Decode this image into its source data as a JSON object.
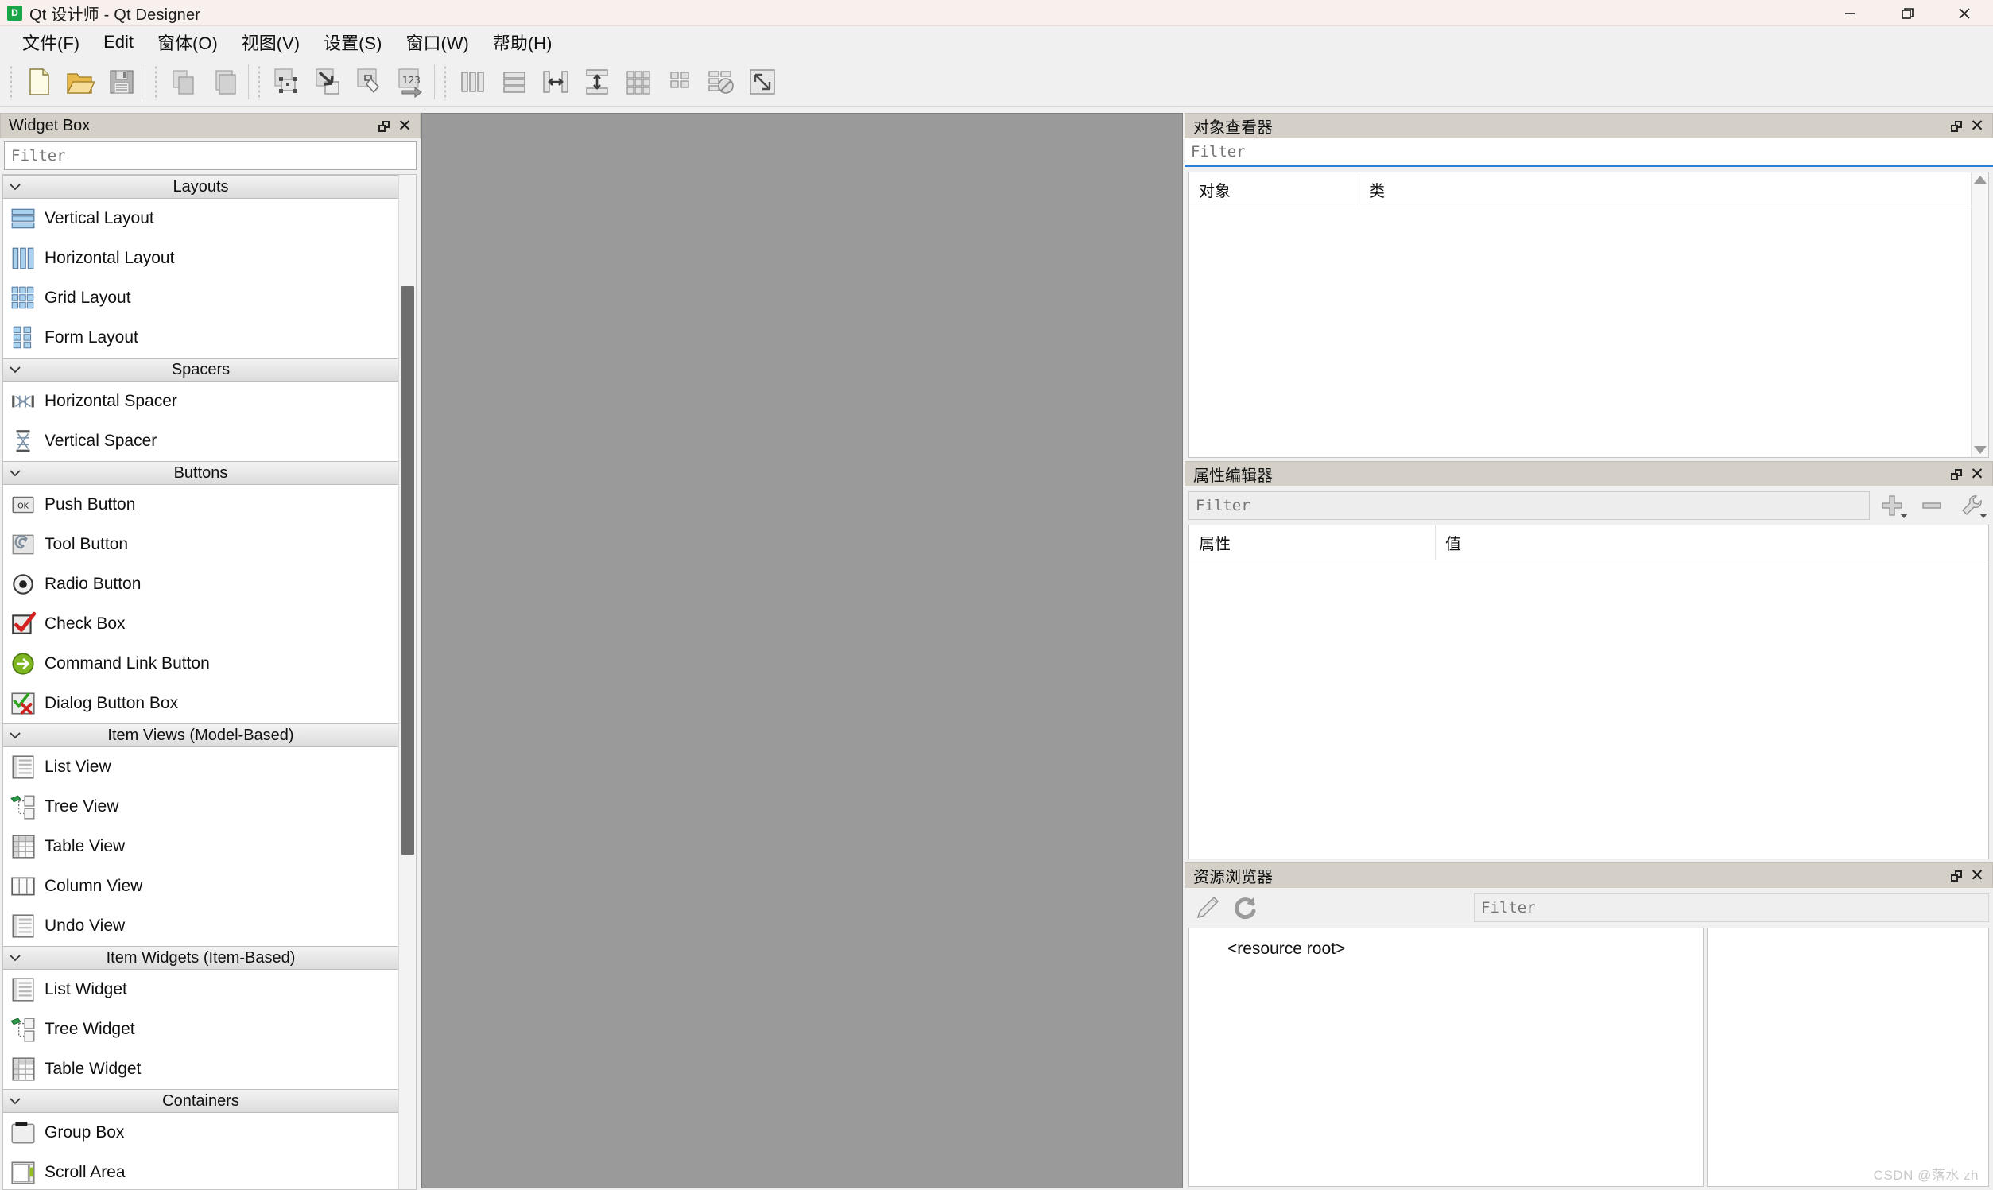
{
  "window": {
    "title": "Qt 设计师 - Qt Designer",
    "app_icon": "qt-designer-icon",
    "minimize_label": "—",
    "maximize_label": "❐",
    "close_label": "✕"
  },
  "menubar": {
    "items": [
      {
        "label": "文件(F)",
        "accel": "F"
      },
      {
        "label": "Edit",
        "accel": "E"
      },
      {
        "label": "窗体(O)",
        "accel": "O"
      },
      {
        "label": "视图(V)",
        "accel": "V"
      },
      {
        "label": "设置(S)",
        "accel": "S"
      },
      {
        "label": "窗口(W)",
        "accel": "W"
      },
      {
        "label": "帮助(H)",
        "accel": "H"
      }
    ]
  },
  "toolbar": {
    "groups": [
      {
        "buttons": [
          {
            "name": "new-form-button",
            "icon": "new-document-icon"
          },
          {
            "name": "open-form-button",
            "icon": "open-folder-icon"
          },
          {
            "name": "save-form-button",
            "icon": "floppy-save-icon"
          }
        ]
      },
      {
        "buttons": [
          {
            "name": "undo-button",
            "icon": "copy-pages-icon"
          },
          {
            "name": "redo-button",
            "icon": "paste-page-icon"
          }
        ]
      },
      {
        "buttons": [
          {
            "name": "edit-widgets-button",
            "icon": "edit-widgets-icon"
          },
          {
            "name": "edit-signals-slots-button",
            "icon": "signals-slots-icon"
          },
          {
            "name": "edit-buddies-button",
            "icon": "buddies-icon"
          },
          {
            "name": "edit-tab-order-button",
            "icon": "tab-order-123-icon"
          }
        ]
      },
      {
        "buttons": [
          {
            "name": "layout-horizontally-button",
            "icon": "layout-horizontal-icon"
          },
          {
            "name": "layout-vertically-button",
            "icon": "layout-vertical-icon"
          },
          {
            "name": "layout-splitter-horizontal-button",
            "icon": "splitter-horizontal-icon"
          },
          {
            "name": "layout-splitter-vertical-button",
            "icon": "splitter-vertical-icon"
          },
          {
            "name": "layout-grid-button",
            "icon": "layout-grid-icon"
          },
          {
            "name": "layout-form-button",
            "icon": "layout-form-icon"
          },
          {
            "name": "break-layout-button",
            "icon": "break-layout-icon"
          },
          {
            "name": "adjust-size-button",
            "icon": "adjust-size-icon"
          }
        ]
      }
    ]
  },
  "widget_box": {
    "title": "Widget Box",
    "filter_placeholder": "Filter",
    "filter_value": "",
    "float_button": "undock",
    "close_button": "close",
    "scroll_thumb": {
      "top_pct": 11,
      "height_pct": 56
    },
    "categories": [
      {
        "label": "Layouts",
        "expanded": true,
        "items": [
          {
            "label": "Vertical Layout",
            "icon": "vertical-layout-icon"
          },
          {
            "label": "Horizontal Layout",
            "icon": "horizontal-layout-icon"
          },
          {
            "label": "Grid Layout",
            "icon": "grid-layout-icon"
          },
          {
            "label": "Form Layout",
            "icon": "form-layout-icon"
          }
        ]
      },
      {
        "label": "Spacers",
        "expanded": true,
        "items": [
          {
            "label": "Horizontal Spacer",
            "icon": "horizontal-spacer-icon"
          },
          {
            "label": "Vertical Spacer",
            "icon": "vertical-spacer-icon"
          }
        ]
      },
      {
        "label": "Buttons",
        "expanded": true,
        "items": [
          {
            "label": "Push Button",
            "icon": "push-button-icon"
          },
          {
            "label": "Tool Button",
            "icon": "tool-button-icon"
          },
          {
            "label": "Radio Button",
            "icon": "radio-button-icon"
          },
          {
            "label": "Check Box",
            "icon": "check-box-icon"
          },
          {
            "label": "Command Link Button",
            "icon": "command-link-icon"
          },
          {
            "label": "Dialog Button Box",
            "icon": "dialog-button-box-icon"
          }
        ]
      },
      {
        "label": "Item Views (Model-Based)",
        "expanded": true,
        "items": [
          {
            "label": "List View",
            "icon": "list-view-icon"
          },
          {
            "label": "Tree View",
            "icon": "tree-view-icon"
          },
          {
            "label": "Table View",
            "icon": "table-view-icon"
          },
          {
            "label": "Column View",
            "icon": "column-view-icon"
          },
          {
            "label": "Undo View",
            "icon": "undo-view-icon"
          }
        ]
      },
      {
        "label": "Item Widgets (Item-Based)",
        "expanded": true,
        "items": [
          {
            "label": "List Widget",
            "icon": "list-widget-icon"
          },
          {
            "label": "Tree Widget",
            "icon": "tree-widget-icon"
          },
          {
            "label": "Table Widget",
            "icon": "table-widget-icon"
          }
        ]
      },
      {
        "label": "Containers",
        "expanded": true,
        "items": [
          {
            "label": "Group Box",
            "icon": "group-box-icon"
          },
          {
            "label": "Scroll Area",
            "icon": "scroll-area-icon"
          }
        ]
      }
    ]
  },
  "object_inspector": {
    "title": "对象查看器",
    "filter_placeholder": "Filter",
    "filter_value": "",
    "columns": [
      "对象",
      "类"
    ],
    "rows": []
  },
  "property_editor": {
    "title": "属性编辑器",
    "filter_placeholder": "Filter",
    "filter_value": "",
    "columns": [
      "属性",
      "值"
    ],
    "rows": [],
    "tools": [
      {
        "name": "add-dynamic-property-button",
        "icon": "plus-icon"
      },
      {
        "name": "remove-dynamic-property-button",
        "icon": "minus-icon"
      },
      {
        "name": "configure-property-editor-button",
        "icon": "wrench-icon"
      }
    ]
  },
  "resource_browser": {
    "title": "资源浏览器",
    "filter_placeholder": "Filter",
    "filter_value": "",
    "tools": [
      {
        "name": "edit-resources-button",
        "icon": "pencil-icon"
      },
      {
        "name": "reload-resources-button",
        "icon": "reload-icon"
      }
    ],
    "tree_root": "<resource root>"
  },
  "canvas": {
    "name": "mdi-workspace"
  },
  "watermark": "CSDN @落水 zh",
  "colors": {
    "titlebar_bg": "#f7f0ec",
    "chrome_bg": "#f0f0f0",
    "dock_title_bg": "#d4d0c8",
    "canvas_bg": "#9a9a9a",
    "accent_blue": "#2a7fd4",
    "scroll_thumb": "#6e6e6e"
  }
}
